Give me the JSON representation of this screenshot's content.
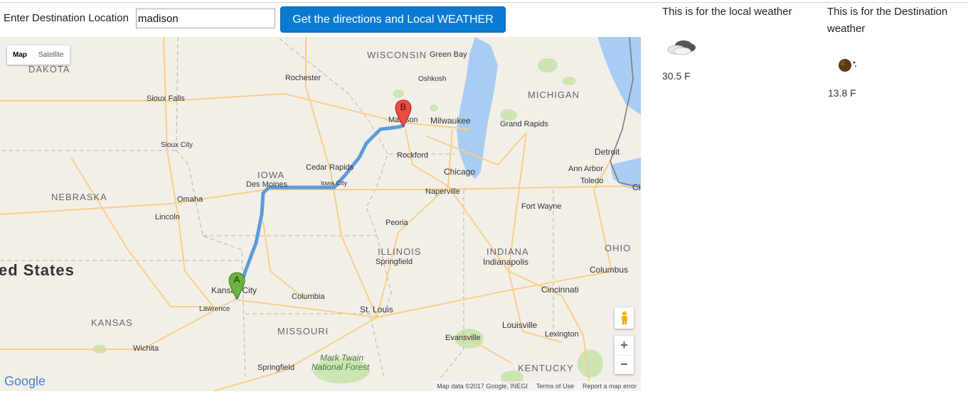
{
  "form": {
    "label": "Enter Destination Location",
    "input_value": "madison",
    "button_label": "Get the directions and Local WEATHER"
  },
  "map": {
    "type_controls": [
      "Map",
      "Satellite"
    ],
    "active_type": "Map",
    "google_logo": "Google",
    "attribution": {
      "data": "Map data ©2017 Google, INEGI",
      "terms": "Terms of Use",
      "report": "Report a map error"
    },
    "zoom_in": "+",
    "zoom_out": "−",
    "markers": {
      "start": "A",
      "end": "B"
    },
    "labels": {
      "states": {
        "wisconsin": "WISCONSIN",
        "dakota": "DAKOTA",
        "iowa": "IOWA",
        "nebraska": "NEBRASKA",
        "illinois": "ILLINOIS",
        "indiana": "INDIANA",
        "ohio": "OHIO",
        "michigan": "MICHIGAN",
        "kansas": "KANSAS",
        "missouri": "MISSOURI",
        "kentucky": "KENTUCKY",
        "country": "ed States"
      },
      "cities": {
        "greenbay": "Green Bay",
        "oshkosh": "Oshkosh",
        "rochester": "Rochester",
        "siouxfalls": "Sioux Falls",
        "madison": "Madison",
        "milwaukee": "Milwaukee",
        "grandrapids": "Grand Rapids",
        "siouxcity": "Sioux City",
        "rockford": "Rockford",
        "detroit": "Detroit",
        "cedarrapids": "Cedar Rapids",
        "chicago": "Chicago",
        "annarbor": "Ann Arbor",
        "desmoines": "Des Moines",
        "iowacity": "Iowa City",
        "naperville": "Naperville",
        "toledo": "Toledo",
        "cl": "Cl",
        "omaha": "Omaha",
        "fortwayne": "Fort Wayne",
        "lincoln": "Lincoln",
        "peoria": "Peoria",
        "springfieldil": "Springfield",
        "indianapolis": "Indianapolis",
        "columbus": "Columbus",
        "kansascity": "Kansas City",
        "cincinnati": "Cincinnati",
        "columbia": "Columbia",
        "lawrence": "Lawrence",
        "stlouis": "St. Louis",
        "louisville": "Louisville",
        "lexington": "Lexington",
        "evansville": "Evansville",
        "wichita": "Wichita",
        "marktwain1": "Mark Twain",
        "marktwain2": "National Forest",
        "springfieldmo": "Springfield"
      }
    }
  },
  "weather": {
    "local": {
      "heading": "This is for the local weather",
      "icon": "partly-cloudy-icon",
      "temp": "30.5 F"
    },
    "destination": {
      "heading": "This is for the Destination weather",
      "icon": "moon-icon",
      "temp": "13.8 F"
    }
  }
}
